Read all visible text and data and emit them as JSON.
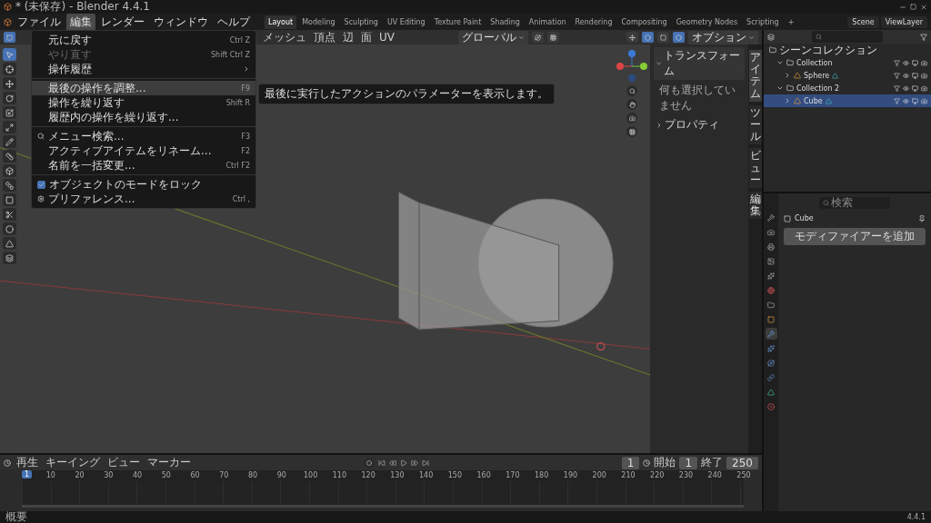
{
  "window": {
    "title": "* (未保存) - Blender 4.4.1"
  },
  "menus": [
    {
      "label": "ファイル",
      "selected": false
    },
    {
      "label": "編集",
      "selected": true
    },
    {
      "label": "レンダー",
      "selected": false
    },
    {
      "label": "ウィンドウ",
      "selected": false
    },
    {
      "label": "ヘルプ",
      "selected": false
    }
  ],
  "workspaces": [
    {
      "label": "Layout",
      "selected": true
    },
    {
      "label": "Modeling",
      "selected": false
    },
    {
      "label": "Sculpting",
      "selected": false
    },
    {
      "label": "UV Editing",
      "selected": false
    },
    {
      "label": "Texture Paint",
      "selected": false
    },
    {
      "label": "Shading",
      "selected": false
    },
    {
      "label": "Animation",
      "selected": false
    },
    {
      "label": "Rendering",
      "selected": false
    },
    {
      "label": "Compositing",
      "selected": false
    },
    {
      "label": "Geometry Nodes",
      "selected": false
    },
    {
      "label": "Scripting",
      "selected": false
    },
    {
      "label": "+",
      "selected": false
    }
  ],
  "scene": "Scene",
  "view_layer": "ViewLayer",
  "viewport": {
    "header_menus": [
      "メッシュ",
      "頂点",
      "辺",
      "面",
      "UV"
    ],
    "transform_orientation": "グローバル",
    "options": "オプション",
    "sidebar": [
      {
        "title": "トランスフォーム",
        "expanded": true,
        "text": "何も選択していません"
      },
      {
        "title": "プロパティ",
        "expanded": false
      }
    ],
    "side_tabs": [
      {
        "label": "アイテム",
        "selected": true
      },
      {
        "label": "ツール",
        "selected": false
      },
      {
        "label": "ビュー",
        "selected": false
      },
      {
        "label": "編集",
        "selected": false
      }
    ]
  },
  "edit_menu": [
    {
      "kind": "item",
      "label": "元に戻す",
      "shortcut": "Ctrl Z",
      "disabled": false,
      "highlighted": false
    },
    {
      "kind": "item",
      "label": "やり直す",
      "shortcut": "Shift Ctrl Z",
      "disabled": true,
      "highlighted": false
    },
    {
      "kind": "submenu",
      "label": "操作履歴",
      "disabled": false,
      "highlighted": false
    },
    {
      "kind": "separator"
    },
    {
      "kind": "item",
      "label": "最後の操作を調整...",
      "shortcut": "F9",
      "disabled": false,
      "highlighted": true
    },
    {
      "kind": "item",
      "label": "操作を繰り返す",
      "shortcut": "Shift R",
      "disabled": false,
      "highlighted": false
    },
    {
      "kind": "item",
      "label": "履歴内の操作を繰り返す...",
      "disabled": false,
      "highlighted": false
    },
    {
      "kind": "separator"
    },
    {
      "kind": "search",
      "label": "メニュー検索...",
      "shortcut": "F3",
      "disabled": false,
      "highlighted": false
    },
    {
      "kind": "item",
      "label": "アクティブアイテムをリネーム...",
      "shortcut": "F2",
      "disabled": false,
      "highlighted": false
    },
    {
      "kind": "item",
      "label": "名前を一括変更...",
      "shortcut": "Ctrl F2",
      "disabled": false,
      "highlighted": false
    },
    {
      "kind": "separator"
    },
    {
      "kind": "check",
      "label": "オブジェクトのモードをロック",
      "checked": true,
      "disabled": false,
      "highlighted": false
    },
    {
      "kind": "prefs",
      "label": "プリファレンス...",
      "shortcut": "Ctrl ,",
      "disabled": false,
      "highlighted": false
    }
  ],
  "tooltip": "最後に実行したアクションのパラメーターを表示します。",
  "outliner": {
    "root": "シーンコレクション",
    "children": [
      {
        "name": "Collection",
        "kind": "collection",
        "expanded": true,
        "selected": false,
        "children": [
          {
            "name": "Sphere",
            "kind": "mesh",
            "expanded": false,
            "selected": false
          }
        ]
      },
      {
        "name": "Collection 2",
        "kind": "collection",
        "expanded": true,
        "selected": false,
        "children": [
          {
            "name": "Cube",
            "kind": "mesh",
            "expanded": false,
            "selected": true
          }
        ]
      }
    ]
  },
  "properties": {
    "search_placeholder": "検索",
    "object": "Cube",
    "add_modifier": "モディファイアーを追加",
    "tabs": [
      {
        "kind": "tool",
        "selected": false
      },
      {
        "kind": "render",
        "selected": false
      },
      {
        "kind": "output",
        "selected": false
      },
      {
        "kind": "view_layer",
        "selected": false
      },
      {
        "kind": "scene",
        "selected": false
      },
      {
        "kind": "world",
        "selected": false
      },
      {
        "kind": "collection",
        "selected": false
      },
      {
        "kind": "object",
        "selected": false
      },
      {
        "kind": "modifiers",
        "selected": true
      },
      {
        "kind": "particles",
        "selected": false
      },
      {
        "kind": "physics",
        "selected": false
      },
      {
        "kind": "constraints",
        "selected": false
      },
      {
        "kind": "data",
        "selected": false
      },
      {
        "kind": "material",
        "selected": false
      }
    ]
  },
  "timeline": {
    "menus": [
      "再生",
      "キーイング",
      "ビュー",
      "マーカー"
    ],
    "current_frame": "1",
    "start_label": "開始",
    "start": "1",
    "end_label": "終了",
    "end": "250",
    "ticks": [
      "1",
      "10",
      "20",
      "30",
      "40",
      "50",
      "60",
      "70",
      "80",
      "90",
      "100",
      "110",
      "120",
      "130",
      "140",
      "150",
      "160",
      "170",
      "180",
      "190",
      "200",
      "210",
      "220",
      "230",
      "240",
      "250"
    ]
  },
  "status_bar": {
    "left": "概要",
    "version": "4.4.1"
  }
}
